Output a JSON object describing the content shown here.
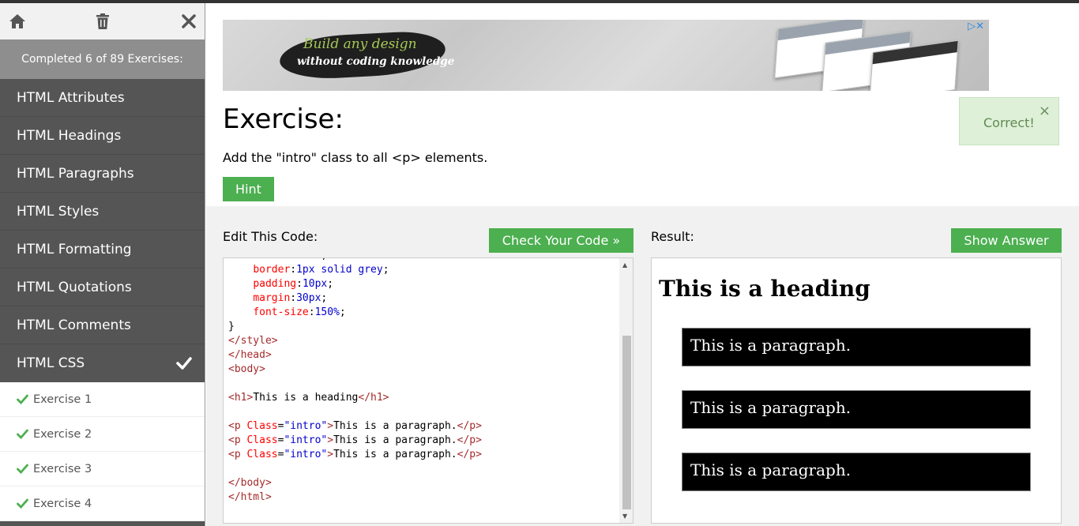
{
  "sidebar": {
    "progress_text": "Completed 6 of 89 Exercises:",
    "items": [
      {
        "label": "HTML Attributes"
      },
      {
        "label": "HTML Headings"
      },
      {
        "label": "HTML Paragraphs"
      },
      {
        "label": "HTML Styles"
      },
      {
        "label": "HTML Formatting"
      },
      {
        "label": "HTML Quotations"
      },
      {
        "label": "HTML Comments"
      },
      {
        "label": "HTML CSS"
      }
    ],
    "sub_items": [
      {
        "label": "Exercise 1"
      },
      {
        "label": "Exercise 2"
      },
      {
        "label": "Exercise 3"
      },
      {
        "label": "Exercise 4"
      }
    ]
  },
  "ad": {
    "line1": "Build any design",
    "line2": "without coding knowledge"
  },
  "exercise": {
    "title": "Exercise:",
    "description": "Add the \"intro\" class to all <p> elements.",
    "hint_label": "Hint"
  },
  "toast": {
    "message": "Correct!",
    "close": "×"
  },
  "editor": {
    "label": "Edit This Code:",
    "check_label": "Check Your Code »"
  },
  "result": {
    "label": "Result:",
    "show_answer_label": "Show Answer",
    "heading": "This is a heading",
    "paragraphs": [
      "This is a paragraph.",
      "This is a paragraph.",
      "This is a paragraph."
    ]
  },
  "colors": {
    "green": "#4caf50",
    "sidebar_bg": "#555555",
    "toast_bg": "#dff0d8"
  }
}
